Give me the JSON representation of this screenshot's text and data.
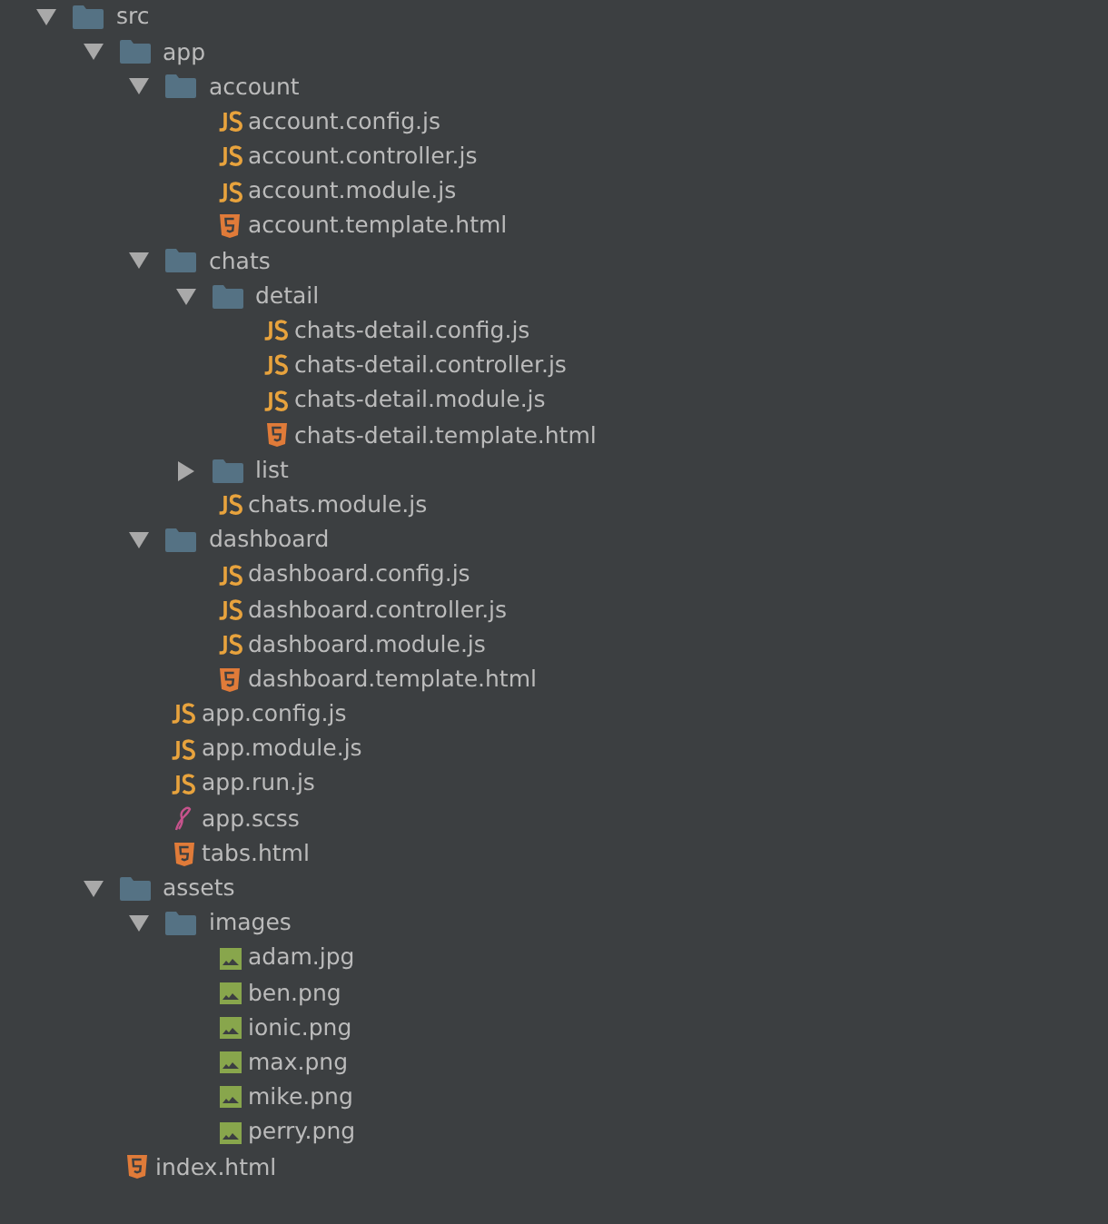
{
  "tree": [
    {
      "kind": "folder",
      "label": "src",
      "expanded": true,
      "children": [
        {
          "kind": "folder",
          "label": "app",
          "expanded": true,
          "children": [
            {
              "kind": "folder",
              "label": "account",
              "expanded": true,
              "children": [
                {
                  "kind": "js",
                  "label": "account.config.js"
                },
                {
                  "kind": "js",
                  "label": "account.controller.js"
                },
                {
                  "kind": "js",
                  "label": "account.module.js"
                },
                {
                  "kind": "html",
                  "label": "account.template.html"
                }
              ]
            },
            {
              "kind": "folder",
              "label": "chats",
              "expanded": true,
              "children": [
                {
                  "kind": "folder",
                  "label": "detail",
                  "expanded": true,
                  "children": [
                    {
                      "kind": "js",
                      "label": "chats-detail.config.js"
                    },
                    {
                      "kind": "js",
                      "label": "chats-detail.controller.js"
                    },
                    {
                      "kind": "js",
                      "label": "chats-detail.module.js"
                    },
                    {
                      "kind": "html",
                      "label": "chats-detail.template.html"
                    }
                  ]
                },
                {
                  "kind": "folder",
                  "label": "list",
                  "expanded": false
                },
                {
                  "kind": "js",
                  "label": "chats.module.js"
                }
              ]
            },
            {
              "kind": "folder",
              "label": "dashboard",
              "expanded": true,
              "children": [
                {
                  "kind": "js",
                  "label": "dashboard.config.js"
                },
                {
                  "kind": "js",
                  "label": "dashboard.controller.js"
                },
                {
                  "kind": "js",
                  "label": "dashboard.module.js"
                },
                {
                  "kind": "html",
                  "label": "dashboard.template.html"
                }
              ]
            },
            {
              "kind": "js",
              "label": "app.config.js"
            },
            {
              "kind": "js",
              "label": "app.module.js"
            },
            {
              "kind": "js",
              "label": "app.run.js"
            },
            {
              "kind": "sass",
              "label": "app.scss"
            },
            {
              "kind": "html",
              "label": "tabs.html"
            }
          ]
        },
        {
          "kind": "folder",
          "label": "assets",
          "expanded": true,
          "children": [
            {
              "kind": "folder",
              "label": "images",
              "expanded": true,
              "children": [
                {
                  "kind": "image",
                  "label": "adam.jpg"
                },
                {
                  "kind": "image",
                  "label": "ben.png"
                },
                {
                  "kind": "image",
                  "label": "ionic.png"
                },
                {
                  "kind": "image",
                  "label": "max.png"
                },
                {
                  "kind": "image",
                  "label": "mike.png"
                },
                {
                  "kind": "image",
                  "label": "perry.png"
                }
              ]
            }
          ]
        },
        {
          "kind": "html",
          "label": "index.html"
        }
      ]
    }
  ]
}
